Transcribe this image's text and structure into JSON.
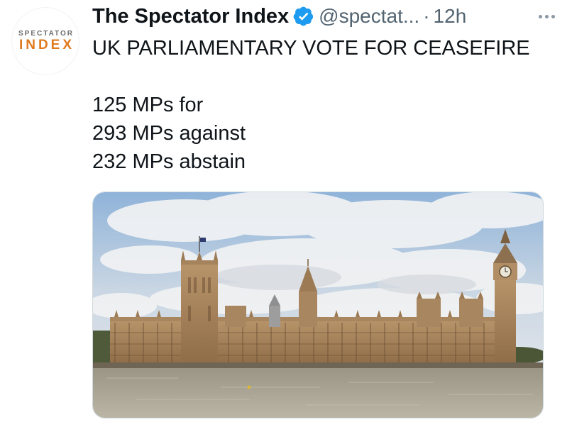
{
  "account": {
    "avatar_text_top": "SPECTATOR",
    "avatar_text_bottom": "INDEX",
    "display_name": "The Spectator Index",
    "verified_icon": "verified-badge-icon",
    "handle": "@spectat...",
    "separator": "·",
    "timestamp": "12h",
    "more_icon": "more-horizontal-icon"
  },
  "tweet": {
    "lines": [
      "UK PARLIAMENTARY VOTE FOR CEASEFIRE",
      "",
      "125 MPs for",
      "293 MPs against",
      "232 MPs abstain"
    ]
  },
  "media": {
    "image_subject": "houses-of-parliament-photo"
  },
  "colors": {
    "text_primary": "#0f1419",
    "text_secondary": "#536471",
    "verified_blue": "#1d9bf0",
    "avatar_orange": "#e07a1f"
  }
}
